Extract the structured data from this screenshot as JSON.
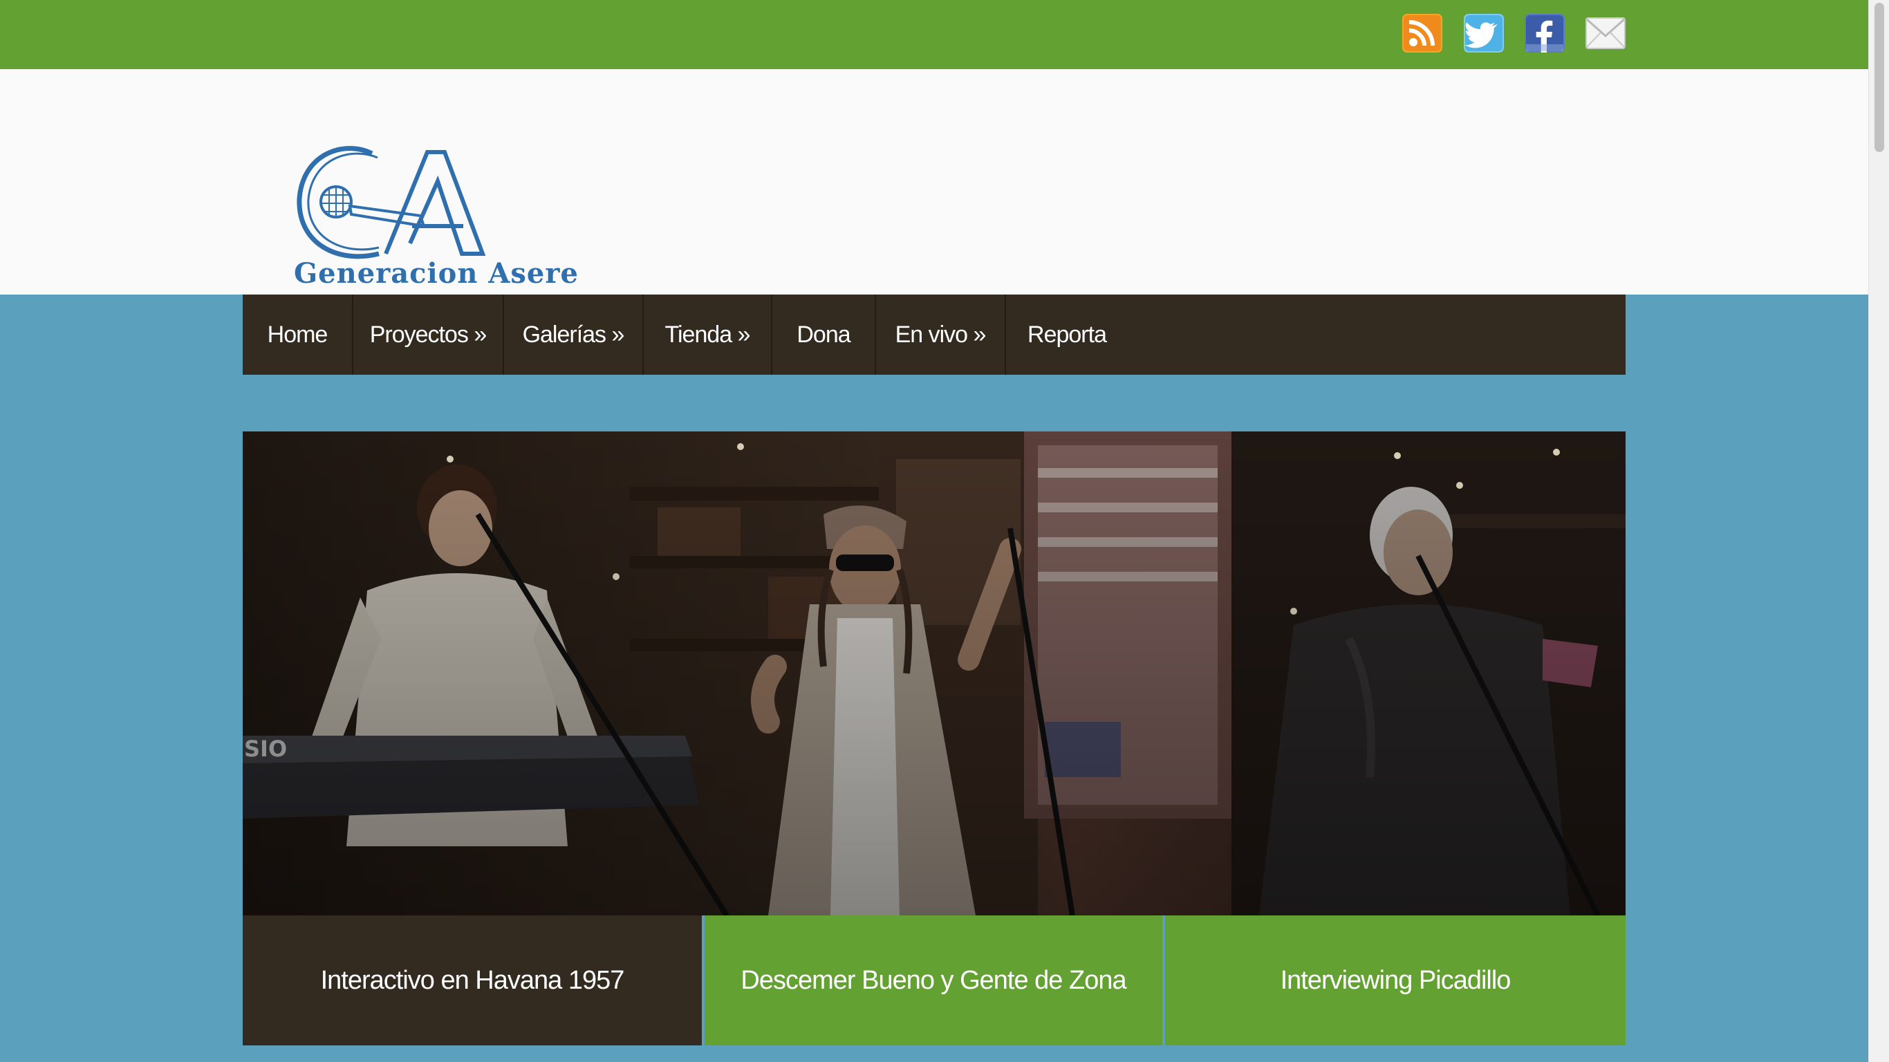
{
  "social": [
    {
      "name": "rss-icon",
      "color": "#f0a030"
    },
    {
      "name": "twitter-icon",
      "color": "#5cb8ea"
    },
    {
      "name": "facebook-icon",
      "color": "#3b5ca8"
    },
    {
      "name": "email-icon",
      "color": "#e4e4e4"
    }
  ],
  "logo": {
    "text": "Generacion Asere",
    "color": "#2f6fae"
  },
  "nav": {
    "items": [
      {
        "label": "Home"
      },
      {
        "label": "Proyectos »"
      },
      {
        "label": "Galerías »"
      },
      {
        "label": "Tienda »"
      },
      {
        "label": "Dona"
      },
      {
        "label": "En vivo »"
      },
      {
        "label": "Reporta"
      }
    ]
  },
  "slider": {
    "image": "band-performance-photo",
    "tabs": [
      {
        "label": "Interactivo en Havana 1957",
        "active": true
      },
      {
        "label": "Descemer Bueno y Gente de Zona",
        "active": false
      },
      {
        "label": "Interviewing Picadillo",
        "active": false
      }
    ]
  },
  "colors": {
    "top_bar": "#64a133",
    "page_background": "#5ba0bc",
    "nav_background": "#332a20",
    "tab_active": "#332a20",
    "tab_inactive": "#64a133"
  }
}
